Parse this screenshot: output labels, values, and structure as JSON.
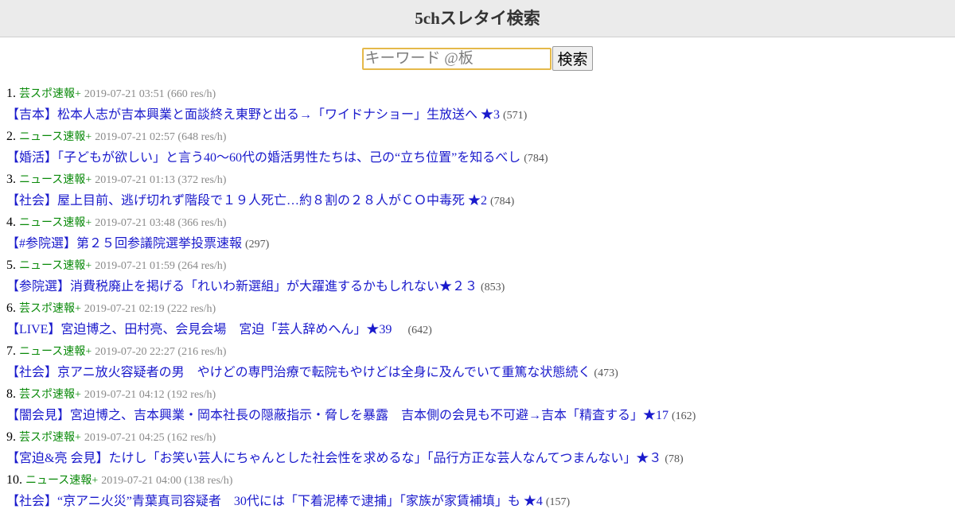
{
  "header": {
    "title": "5chスレタイ検索"
  },
  "search": {
    "placeholder": "キーワード @板",
    "value": "",
    "button_label": "検索"
  },
  "results": [
    {
      "num": "1.",
      "board": "芸スポ速報+",
      "meta": "2019-07-21 03:51 (660 res/h)",
      "title": "【吉本】松本人志が吉本興業と面談終え東野と出る→「ワイドナショー」生放送へ ★3",
      "count": "(571)"
    },
    {
      "num": "2.",
      "board": "ニュース速報+",
      "meta": "2019-07-21 02:57 (648 res/h)",
      "title": "【婚活】「子どもが欲しい」と言う40～60代の婚活男性たちは、己の“立ち位置”を知るべし",
      "count": "(784)"
    },
    {
      "num": "3.",
      "board": "ニュース速報+",
      "meta": "2019-07-21 01:13 (372 res/h)",
      "title": "【社会】屋上目前、逃げ切れず階段で１９人死亡…約８割の２８人がＣＯ中毒死 ★2",
      "count": "(784)"
    },
    {
      "num": "4.",
      "board": "ニュース速報+",
      "meta": "2019-07-21 03:48 (366 res/h)",
      "title": "【#参院選】第２５回参議院選挙投票速報",
      "count": "(297)"
    },
    {
      "num": "5.",
      "board": "ニュース速報+",
      "meta": "2019-07-21 01:59 (264 res/h)",
      "title": "【参院選】消費税廃止を掲げる「れいわ新選組」が大躍進するかもしれない★２３",
      "count": "(853)"
    },
    {
      "num": "6.",
      "board": "芸スポ速報+",
      "meta": "2019-07-21 02:19 (222 res/h)",
      "title": "【LIVE】宮迫博之、田村亮、会見会場　宮迫「芸人辞めへん」★39　",
      "count": "(642)"
    },
    {
      "num": "7.",
      "board": "ニュース速報+",
      "meta": "2019-07-20 22:27 (216 res/h)",
      "title": "【社会】京アニ放火容疑者の男　やけどの専門治療で転院もやけどは全身に及んでいて重篤な状態続く",
      "count": "(473)"
    },
    {
      "num": "8.",
      "board": "芸スポ速報+",
      "meta": "2019-07-21 04:12 (192 res/h)",
      "title": "【闇会見】宮迫博之、吉本興業・岡本社長の隠蔽指示・脅しを暴露　吉本側の会見も不可避→吉本「精査する」★17",
      "count": "(162)"
    },
    {
      "num": "9.",
      "board": "芸スポ速報+",
      "meta": "2019-07-21 04:25 (162 res/h)",
      "title": "【宮迫&亮 会見】たけし「お笑い芸人にちゃんとした社会性を求めるな」「品行方正な芸人なんてつまんない」★３",
      "count": "(78)"
    },
    {
      "num": "10.",
      "board": "ニュース速報+",
      "meta": "2019-07-21 04:00 (138 res/h)",
      "title": "【社会】“京アニ火災”青葉真司容疑者　30代には「下着泥棒で逮捕」「家族が家賃補填」も ★4",
      "count": "(157)"
    }
  ]
}
